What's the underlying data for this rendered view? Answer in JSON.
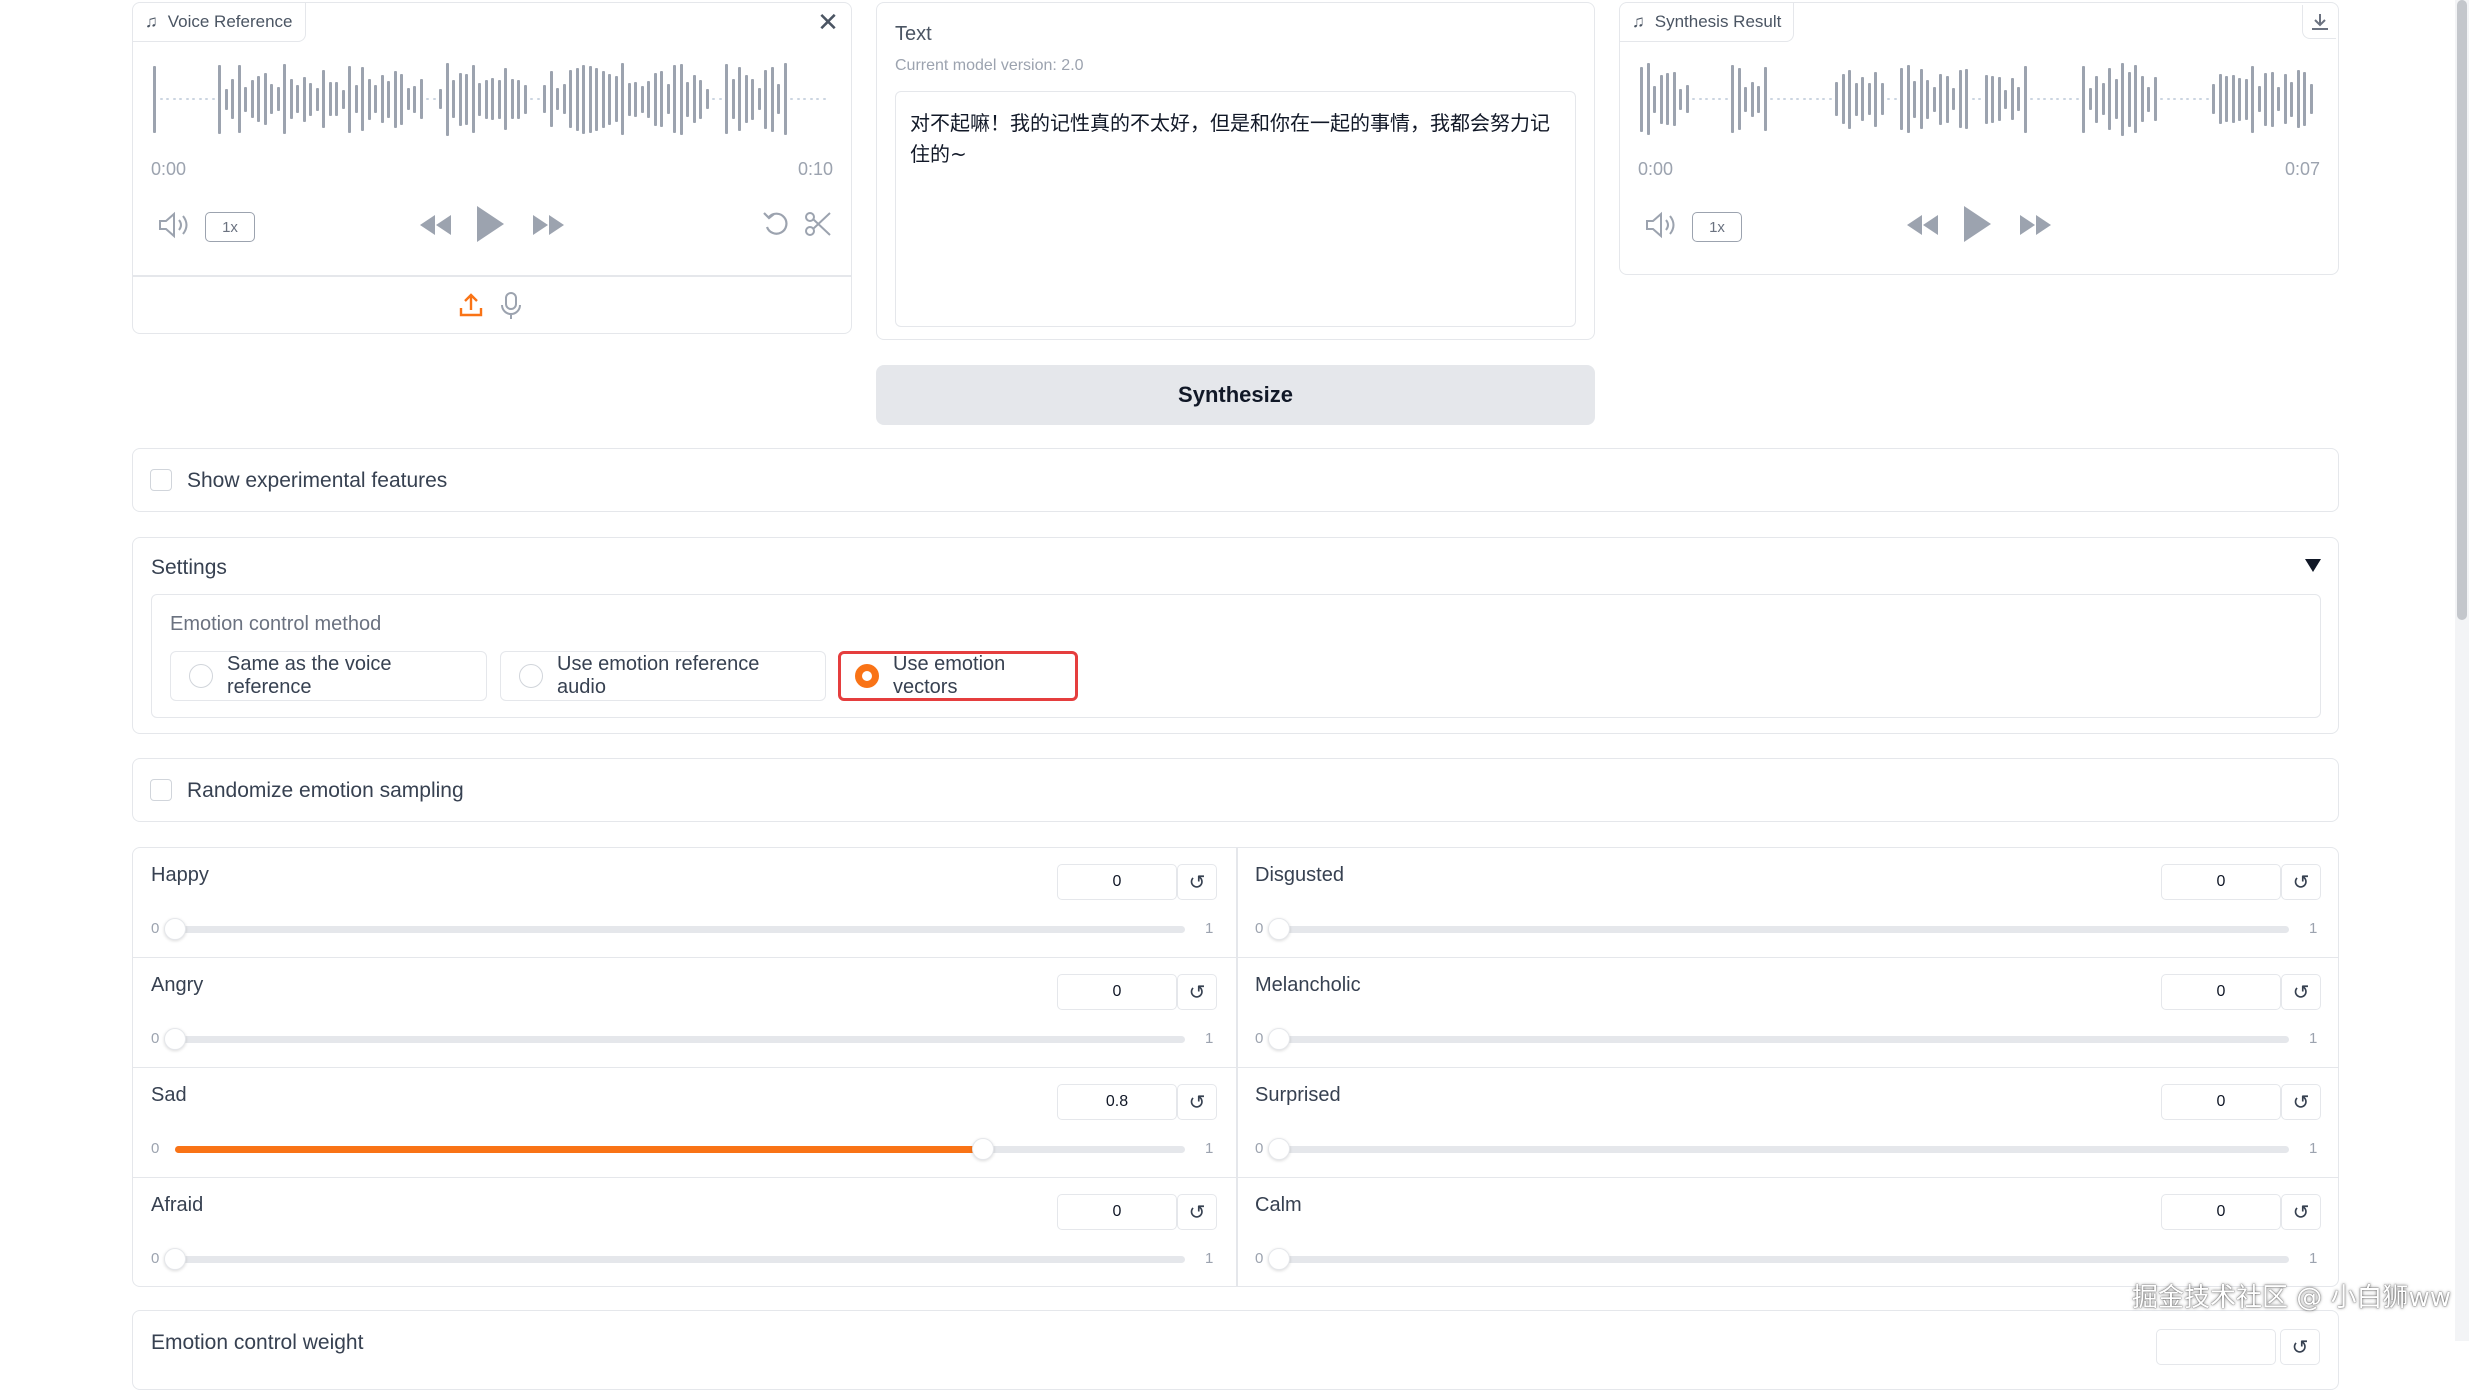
{
  "voice_reference": {
    "label": "Voice Reference",
    "time_start": "0:00",
    "time_end": "0:10",
    "speed": "1x"
  },
  "text_panel": {
    "label": "Text",
    "version": "Current model version: 2.0",
    "content": "对不起嘛！我的记性真的不太好，但是和你在一起的事情，我都会努力记住的~"
  },
  "synthesis_result": {
    "label": "Synthesis Result",
    "time_start": "0:00",
    "time_end": "0:07",
    "speed": "1x"
  },
  "synthesize_button": "Synthesize",
  "experimental": {
    "label": "Show experimental features",
    "checked": false
  },
  "settings": {
    "title": "Settings",
    "emotion_method_label": "Emotion control method",
    "options": [
      {
        "label": "Same as the voice reference",
        "selected": false
      },
      {
        "label": "Use emotion reference audio",
        "selected": false
      },
      {
        "label": "Use emotion vectors",
        "selected": true
      }
    ]
  },
  "randomize": {
    "label": "Randomize emotion sampling",
    "checked": false
  },
  "emotions": [
    {
      "name": "Happy",
      "value": "0",
      "fraction": 0,
      "min": "0",
      "max": "1"
    },
    {
      "name": "Disgusted",
      "value": "0",
      "fraction": 0,
      "min": "0",
      "max": "1"
    },
    {
      "name": "Angry",
      "value": "0",
      "fraction": 0,
      "min": "0",
      "max": "1"
    },
    {
      "name": "Melancholic",
      "value": "0",
      "fraction": 0,
      "min": "0",
      "max": "1"
    },
    {
      "name": "Sad",
      "value": "0.8",
      "fraction": 0.8,
      "min": "0",
      "max": "1"
    },
    {
      "name": "Surprised",
      "value": "0",
      "fraction": 0,
      "min": "0",
      "max": "1"
    },
    {
      "name": "Afraid",
      "value": "0",
      "fraction": 0,
      "min": "0",
      "max": "1"
    },
    {
      "name": "Calm",
      "value": "0",
      "fraction": 0,
      "min": "0",
      "max": "1"
    }
  ],
  "emotion_weight_label": "Emotion control weight",
  "watermark": "掘金技术社区 @ 小白狮ww",
  "colors": {
    "accent": "#f97316",
    "highlight_box": "#e53e3e",
    "border": "#e5e7eb"
  }
}
